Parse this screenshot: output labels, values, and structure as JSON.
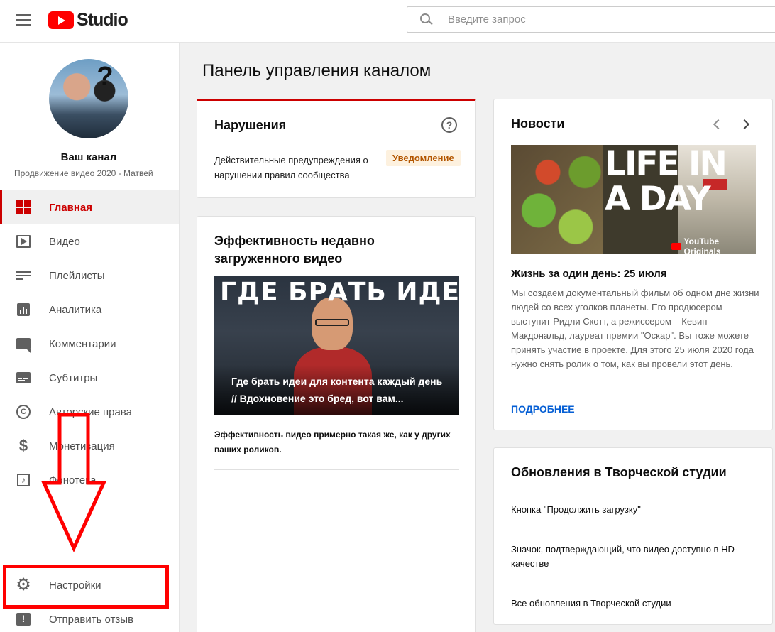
{
  "header": {
    "logo_text": "Studio",
    "search_placeholder": "Введите запрос"
  },
  "sidebar": {
    "channel_name": "Ваш канал",
    "channel_subtitle": "Продвижение видео 2020 - Матвей",
    "avatar_overlay": "?",
    "items": [
      {
        "label": "Главная",
        "icon": "dashboard-icon",
        "active": true
      },
      {
        "label": "Видео",
        "icon": "video-icon"
      },
      {
        "label": "Плейлисты",
        "icon": "playlist-icon"
      },
      {
        "label": "Аналитика",
        "icon": "analytics-icon"
      },
      {
        "label": "Комментарии",
        "icon": "comment-icon"
      },
      {
        "label": "Субтитры",
        "icon": "subtitles-icon"
      },
      {
        "label": "Авторские права",
        "icon": "copyright-icon"
      },
      {
        "label": "Монетизация",
        "icon": "dollar-icon"
      },
      {
        "label": "Фонотека",
        "icon": "audio-library-icon"
      }
    ],
    "bottom_items": [
      {
        "label": "Настройки",
        "icon": "gear-icon"
      },
      {
        "label": "Отправить отзыв",
        "icon": "feedback-icon"
      }
    ]
  },
  "main": {
    "page_title": "Панель управления каналом",
    "violations": {
      "title": "Нарушения",
      "text": "Действительные предупреждения о нарушении правил сообщества",
      "badge": "Уведомление"
    },
    "performance": {
      "title": "Эффективность недавно загруженного видео",
      "thumb_headline": "ГДЕ БРАТЬ ИДЕИ",
      "video_title": "Где брать идеи для контента каждый день // Вдохновение это бред, вот вам...",
      "summary": "Эффективность видео примерно такая же, как у других ваших роликов."
    },
    "news": {
      "title": "Новости",
      "image_text": "LIFE IN A DAY",
      "image_badge": "YouTube Originals",
      "headline": "Жизнь за один день: 25 июля",
      "body": "Мы создаем документальный фильм об одном дне жизни людей со всех уголков планеты. Его продюсером выступит Ридли Скотт, а режиссером – Кевин Макдональд, лауреат премии \"Оскар\". Вы тоже можете принять участие в проекте. Для этого 25 июля 2020 года нужно снять ролик о том, как вы провели этот день.",
      "more_link": "ПОДРОБНЕЕ"
    },
    "updates": {
      "title": "Обновления в Творческой студии",
      "items": [
        "Кнопка \"Продолжить загрузку\"",
        "Значок, подтверждающий, что видео доступно в HD-качестве",
        "Все обновления в Творческой студии"
      ]
    }
  },
  "colors": {
    "accent_red": "#cc0000",
    "annotation_red": "#ff0000",
    "link_blue": "#065fd4"
  }
}
